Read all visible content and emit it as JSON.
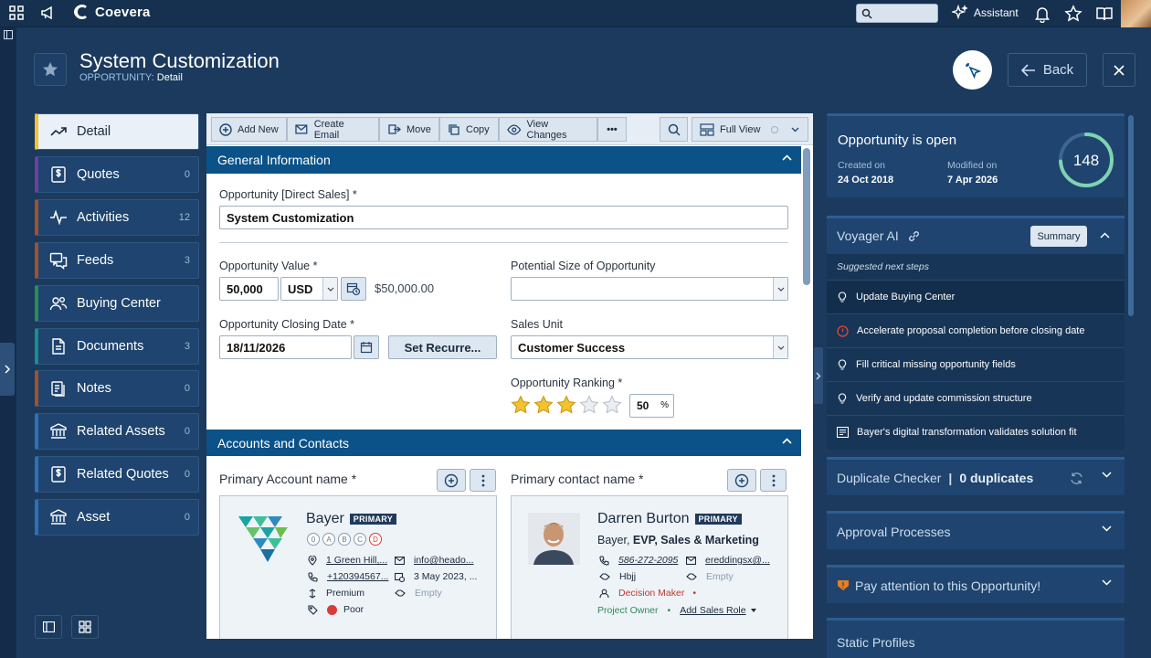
{
  "topbar": {
    "brand": "Coevera",
    "assistant_label": "Assistant"
  },
  "header": {
    "title": "System Customization",
    "entity": "OPPORTUNITY:",
    "view": "Detail",
    "back_label": "Back"
  },
  "nav": {
    "items": [
      {
        "label": "Detail",
        "count": "",
        "color": "#f2c230",
        "icon": "trend-icon"
      },
      {
        "label": "Quotes",
        "count": "0",
        "color": "#6b3fa0",
        "icon": "dollar-doc-icon"
      },
      {
        "label": "Activities",
        "count": "12",
        "color": "#a0522d",
        "icon": "pulse-icon"
      },
      {
        "label": "Feeds",
        "count": "3",
        "color": "#a0522d",
        "icon": "chat-icon"
      },
      {
        "label": "Buying Center",
        "count": "",
        "color": "#2e8b57",
        "icon": "people-icon"
      },
      {
        "label": "Documents",
        "count": "3",
        "color": "#1e8c8c",
        "icon": "document-icon"
      },
      {
        "label": "Notes",
        "count": "0",
        "color": "#a0522d",
        "icon": "notes-icon"
      },
      {
        "label": "Related Assets",
        "count": "0",
        "color": "#2f6fb3",
        "icon": "asset-icon"
      },
      {
        "label": "Related Quotes",
        "count": "0",
        "color": "#2f6fb3",
        "icon": "dollar-doc-icon"
      },
      {
        "label": "Asset",
        "count": "0",
        "color": "#2f6fb3",
        "icon": "asset-icon"
      }
    ]
  },
  "toolbar": {
    "add_new": "Add New",
    "create_email": "Create Email",
    "move": "Move",
    "copy": "Copy",
    "view_changes": "View Changes",
    "more": "•••",
    "full_view": "Full View"
  },
  "general": {
    "section_title": "General Information",
    "opp_label": "Opportunity [Direct Sales] *",
    "opp_value": "System Customization",
    "value_label": "Opportunity Value *",
    "value_amount": "50,000",
    "currency": "USD",
    "value_formatted": "$50,000.00",
    "potential_label": "Potential Size of Opportunity",
    "potential_value": "",
    "closing_label": "Opportunity Closing Date *",
    "closing_value": "18/11/2026",
    "recurrence_label": "Set Recurre...",
    "sales_unit_label": "Sales Unit",
    "sales_unit_value": "Customer Success",
    "ranking_label": "Opportunity Ranking *",
    "ranking_stars": 3,
    "ranking_max": 5,
    "ranking_percent": "50",
    "percent_sign": "%"
  },
  "accounts": {
    "section_title": "Accounts and Contacts",
    "account_label": "Primary Account name *",
    "contact_label": "Primary contact name *",
    "account": {
      "name": "Bayer",
      "badge": "PRIMARY",
      "grades": [
        "0",
        "A",
        "B",
        "C",
        "D"
      ],
      "address": "1 Green Hill,...",
      "email": "info@heado...",
      "phone": "+120394567...",
      "date": "3 May 2023, ...",
      "tier": "Premium",
      "tier_extra": "Empty",
      "rating": "Poor",
      "rating_color": "#d93b3b"
    },
    "contact": {
      "name": "Darren Burton",
      "badge": "PRIMARY",
      "company": "Bayer,",
      "title": "EVP, Sales & Marketing",
      "phone": "586-272-2095",
      "email": "ereddingsx@...",
      "handle": "Hbjj",
      "handle_extra": "Empty",
      "role": "Decision Maker",
      "project_role": "Project Owner",
      "add_role": "Add Sales Role"
    }
  },
  "right": {
    "status_title": "Opportunity is open",
    "created_label": "Created on",
    "created_value": "24 Oct 2018",
    "modified_label": "Modified on",
    "modified_value": "7 Apr 2026",
    "score": "148",
    "score_fraction": 0.74,
    "ai_title": "Voyager AI",
    "summary_label": "Summary",
    "suggested_label": "Suggested next steps",
    "suggestions": [
      {
        "text": "Update Buying Center",
        "icon": "lightbulb-icon"
      },
      {
        "text": "Accelerate proposal completion before closing date",
        "icon": "alert-icon"
      },
      {
        "text": "Fill critical missing opportunity fields",
        "icon": "lightbulb-icon"
      },
      {
        "text": "Verify and update commission structure",
        "icon": "lightbulb-icon"
      },
      {
        "text": "Bayer's digital transformation validates solution fit",
        "icon": "news-icon"
      }
    ],
    "dup_label": "Duplicate Checker",
    "dup_sep": "|",
    "dup_count": "0 duplicates",
    "approval_label": "Approval Processes",
    "attention_label": "Pay attention to this Opportunity!",
    "static_label": "Static Profiles"
  },
  "colors": {
    "bg": "#1b3a5e",
    "section": "#0a5288",
    "star": "#f2c230",
    "accent_ring": "#7fd3b0"
  }
}
